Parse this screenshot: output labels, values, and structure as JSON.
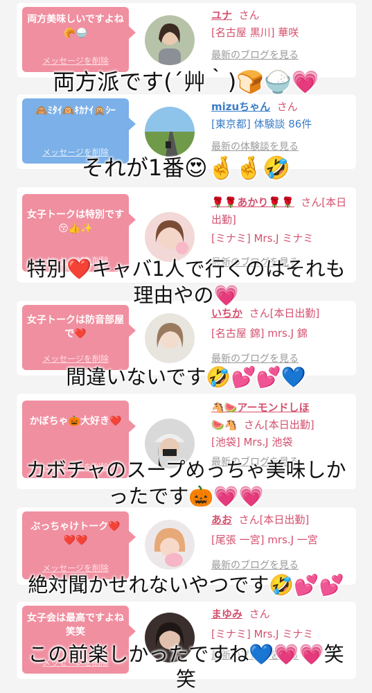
{
  "entries": [
    {
      "message": "両方美味しいですよね🥐🍚",
      "delete": "メッセージを削除",
      "name": "ユナ",
      "san": "さん",
      "area": "[名古屋 黒川] 華咲",
      "link": "最新のブログを見る",
      "bubble_color": "#f08fa0"
    },
    {
      "message": "🙈ﾐﾀｲ🙉ｷｶﾅｲ🙊ｼｰ",
      "delete": "メッセージを削除",
      "name": "mizuちゃん",
      "san": "さん",
      "area": "[東京都] 体験談 86件",
      "link": "最新の体験談を見る",
      "bubble_color": "#7bb0e8"
    },
    {
      "message": "女子トークは特別です😚👍✨",
      "delete": "メッセージを削除",
      "name": "🌹🌹あかり🌹🌹",
      "san": "さん[本日出勤]",
      "area": "[ミナミ] Mrs.J ミナミ",
      "link": "最新のブログを見る",
      "bubble_color": "#f08fa0"
    },
    {
      "message": "女子トークは防音部屋で❤️",
      "delete": "メッセージを削除",
      "name": "いちか",
      "san": "さん[本日出勤]",
      "area": "[名古屋 錦] mrs.J 錦",
      "link": "最新のブログを見る",
      "bubble_color": "#f08fa0"
    },
    {
      "message": "かぼちゃ🎃大好き❤️",
      "delete": "メッセージを削除",
      "name": "🐴🍉アーモンドしほ",
      "name2": "🍉🐴",
      "san": "さん[本日出勤]",
      "area": "[池袋] Mrs.J 池袋",
      "link": "最新のブログを見る",
      "bubble_color": "#f08fa0"
    },
    {
      "message": "ぶっちゃけトーク❤️❤️❤️",
      "delete": "メッセージを削除",
      "name": "あお",
      "san": "さん[本日出勤]",
      "area": "[尾張 一宮] mrs.J 一宮",
      "link": "最新のブログを見る",
      "bubble_color": "#f08fa0"
    },
    {
      "message": "女子会は最高ですよね笑笑",
      "delete": "メッセージを削除",
      "name": "まゆみ",
      "san": "さん",
      "area": "[ミナミ] Mrs.J ミナミ",
      "link": "最新のブログを見る",
      "bubble_color": "#f08fa0"
    }
  ],
  "overlays": {
    "o1": "両方派です(´艸｀)🍞🍚💗",
    "o2": "それが1番😍🤞🤞🤣",
    "o3a": "特別❤️キャバ1人で行くのはそれも",
    "o3b": "理由やの💗",
    "o4": "間違いないです🤣💕💕💙",
    "o5a": "カボチャのスープめっちゃ美味しか",
    "o5b": "ったです🎃💗💗",
    "o6": "絶対聞かせれないやつです🤣💕💕",
    "o7a": "この前楽しかったですね💙💗💗笑",
    "o7b": "笑"
  }
}
